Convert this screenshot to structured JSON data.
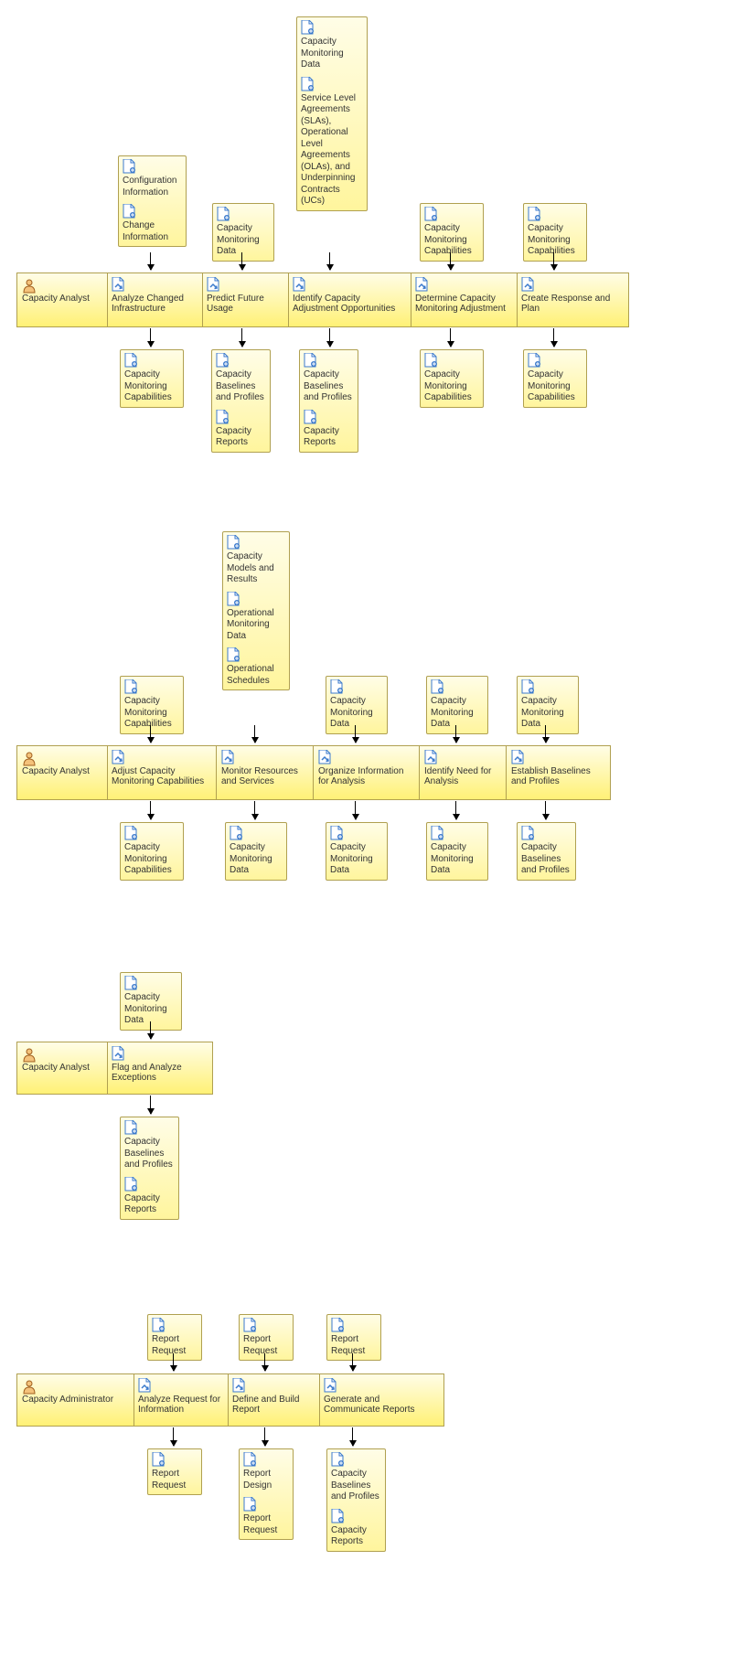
{
  "icons": {
    "doc": 1,
    "person": 1,
    "task": 1
  },
  "lane1": {
    "role": "Capacity Analyst",
    "inputs": {
      "c1a": "Configuration Information",
      "c1b": "Change Information",
      "c2": "Capacity Monitoring Data",
      "c3a": "Capacity Monitoring Data",
      "c3b": "Service Level Agreements (SLAs), Operational Level Agreements (OLAs), and Underpinning Contracts (UCs)",
      "c4": "Capacity Monitoring Capabilities",
      "c5": "Capacity Monitoring Capabilities"
    },
    "tasks": {
      "c1": "Analyze Changed Infrastructure",
      "c2": "Predict Future Usage",
      "c3": "Identify Capacity Adjustment Opportunities",
      "c4": "Determine Capacity Monitoring Adjustment",
      "c5": "Create Response and Plan"
    },
    "outputs": {
      "c1": "Capacity Monitoring Capabilities",
      "c2a": "Capacity Baselines and Profiles",
      "c2b": "Capacity Reports",
      "c3a": "Capacity Baselines and Profiles",
      "c3b": "Capacity Reports",
      "c4": "Capacity Monitoring Capabilities",
      "c5": "Capacity Monitoring Capabilities"
    }
  },
  "lane2": {
    "role": "Capacity Analyst",
    "inputs": {
      "c1": "Capacity Monitoring Capabilities",
      "c2a": "Capacity Models and Results",
      "c2b": "Operational Monitoring Data",
      "c2c": "Operational Schedules",
      "c3": "Capacity Monitoring Data",
      "c4": "Capacity Monitoring Data",
      "c5": "Capacity Monitoring Data"
    },
    "tasks": {
      "c1": "Adjust Capacity Monitoring Capabilities",
      "c2": "Monitor Resources and Services",
      "c3": "Organize Information for Analysis",
      "c4": "Identify Need for Analysis",
      "c5": "Establish Baselines and Profiles"
    },
    "outputs": {
      "c1": "Capacity Monitoring Capabilities",
      "c2": "Capacity Monitoring Data",
      "c3": "Capacity Monitoring Data",
      "c4": "Capacity Monitoring Data",
      "c5": "Capacity Baselines and Profiles"
    }
  },
  "lane3": {
    "role": "Capacity Analyst",
    "inputs": {
      "c1": "Capacity Monitoring Data"
    },
    "tasks": {
      "c1": "Flag and Analyze Exceptions"
    },
    "outputs": {
      "c1a": "Capacity Baselines and Profiles",
      "c1b": "Capacity Reports"
    }
  },
  "lane4": {
    "role": "Capacity Administrator",
    "inputs": {
      "c1": "Report Request",
      "c2": "Report Request",
      "c3": "Report Request"
    },
    "tasks": {
      "c1": "Analyze Request for Information",
      "c2": "Define and Build Report",
      "c3": "Generate and Communicate Reports"
    },
    "outputs": {
      "c1": "Report Request",
      "c2a": "Report Design",
      "c2b": "Report Request",
      "c3a": "Capacity Baselines and Profiles",
      "c3b": "Capacity Reports"
    }
  }
}
